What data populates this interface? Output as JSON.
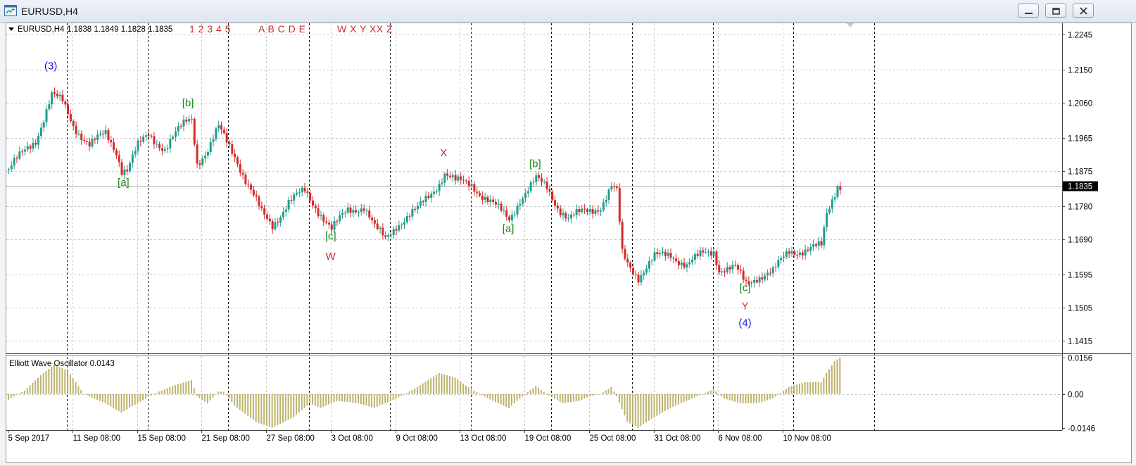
{
  "window": {
    "title": "EURUSD,H4",
    "app_icon": "chart-window-icon",
    "controls": [
      "minimize-icon",
      "restore-icon",
      "close-icon"
    ]
  },
  "header": {
    "symbol_tf": "EURUSD,H4",
    "ohlc": "1.1838 1.1849 1.1828 1.1835",
    "wave_tools": [
      "1 2 3 4 5",
      "A B C D E",
      "W X Y XX Z"
    ]
  },
  "colors": {
    "bull": "#1e9e8c",
    "bear": "#d42a2a",
    "oscillator": "#bdb36b",
    "green_label": "#1a8a1a",
    "red_label": "#cc2a2a",
    "blue_label": "#1414cc"
  },
  "chart_data": [
    {
      "type": "candlestick",
      "symbol": "EURUSD",
      "timeframe": "H4",
      "y_ticks": [
        "1.2245",
        "1.2150",
        "1.2060",
        "1.1965",
        "1.1875",
        "1.1780",
        "1.1690",
        "1.1595",
        "1.1505",
        "1.1415"
      ],
      "ylim": [
        1.1385,
        1.2275
      ],
      "current_price": "1.1835",
      "x_ticks": [
        "5 Sep 2017",
        "11 Sep 08:00",
        "15 Sep 08:00",
        "21 Sep 08:00",
        "27 Sep 08:00",
        "3 Oct 08:00",
        "9 Oct 08:00",
        "13 Oct 08:00",
        "19 Oct 08:00",
        "25 Oct 08:00",
        "31 Oct 08:00",
        "6 Nov 08:00",
        "10 Nov 08:00"
      ],
      "x_tick_index": [
        0,
        24,
        48,
        72,
        96,
        120,
        144,
        168,
        192,
        216,
        240,
        264,
        288
      ],
      "day_separators_index": [
        22,
        52,
        82,
        112,
        142,
        172,
        202,
        232,
        262,
        292,
        322
      ],
      "waypoints": [
        [
          0,
          1.188
        ],
        [
          10,
          1.196
        ],
        [
          16,
          1.208
        ],
        [
          20,
          1.206
        ],
        [
          24,
          1.2
        ],
        [
          30,
          1.1945
        ],
        [
          36,
          1.1975
        ],
        [
          40,
          1.193
        ],
        [
          42,
          1.188
        ],
        [
          44,
          1.188
        ],
        [
          48,
          1.194
        ],
        [
          52,
          1.1975
        ],
        [
          58,
          1.1935
        ],
        [
          66,
          1.201
        ],
        [
          68,
          1.202
        ],
        [
          70,
          1.19
        ],
        [
          74,
          1.193
        ],
        [
          78,
          1.199
        ],
        [
          84,
          1.192
        ],
        [
          88,
          1.185
        ],
        [
          94,
          1.176
        ],
        [
          98,
          1.173
        ],
        [
          104,
          1.179
        ],
        [
          110,
          1.182
        ],
        [
          116,
          1.176
        ],
        [
          120,
          1.1715
        ],
        [
          126,
          1.177
        ],
        [
          132,
          1.178
        ],
        [
          136,
          1.172
        ],
        [
          140,
          1.169
        ],
        [
          144,
          1.173
        ],
        [
          152,
          1.177
        ],
        [
          160,
          1.1845
        ],
        [
          162,
          1.187
        ],
        [
          166,
          1.1845
        ],
        [
          172,
          1.184
        ],
        [
          176,
          1.181
        ],
        [
          182,
          1.177
        ],
        [
          186,
          1.1745
        ],
        [
          190,
          1.18
        ],
        [
          196,
          1.185
        ],
        [
          200,
          1.183
        ],
        [
          204,
          1.178
        ],
        [
          208,
          1.1745
        ],
        [
          214,
          1.1765
        ],
        [
          220,
          1.178
        ],
        [
          224,
          1.183
        ],
        [
          226,
          1.1815
        ],
        [
          228,
          1.165
        ],
        [
          230,
          1.1625
        ],
        [
          234,
          1.159
        ],
        [
          240,
          1.164
        ],
        [
          246,
          1.165
        ],
        [
          252,
          1.162
        ],
        [
          258,
          1.165
        ],
        [
          262,
          1.166
        ],
        [
          264,
          1.161
        ],
        [
          270,
          1.161
        ],
        [
          274,
          1.157
        ],
        [
          278,
          1.159
        ],
        [
          284,
          1.16
        ],
        [
          290,
          1.166
        ],
        [
          296,
          1.166
        ],
        [
          302,
          1.167
        ],
        [
          304,
          1.176
        ],
        [
          306,
          1.18
        ],
        [
          308,
          1.184
        ],
        [
          309,
          1.1835
        ]
      ],
      "wave_labels": [
        {
          "text": "(3)",
          "color": "blue",
          "index": 16,
          "price": 1.215
        },
        {
          "text": "[b]",
          "color": "green",
          "index": 67,
          "price": 1.205
        },
        {
          "text": "[a]",
          "color": "green",
          "index": 43,
          "price": 1.1835
        },
        {
          "text": "[c]",
          "color": "green",
          "index": 120,
          "price": 1.169
        },
        {
          "text": "W",
          "color": "red",
          "index": 120,
          "price": 1.1635
        },
        {
          "text": "X",
          "color": "red",
          "index": 162,
          "price": 1.1915
        },
        {
          "text": "[b]",
          "color": "green",
          "index": 196,
          "price": 1.1885
        },
        {
          "text": "[a]",
          "color": "green",
          "index": 186,
          "price": 1.171
        },
        {
          "text": "[c]",
          "color": "green",
          "index": 274,
          "price": 1.155
        },
        {
          "text": "Y",
          "color": "red",
          "index": 274,
          "price": 1.15
        },
        {
          "text": "(4)",
          "color": "blue",
          "index": 274,
          "price": 1.1455
        }
      ]
    },
    {
      "type": "bar",
      "title": "Elliott Wave Oscillator 0.0143",
      "y_ticks": [
        "0.0156",
        "0.00",
        "-0.0146"
      ],
      "ylim": [
        -0.0155,
        0.0165
      ],
      "waypoints": [
        [
          0,
          -0.0025
        ],
        [
          6,
          0.0015
        ],
        [
          12,
          0.008
        ],
        [
          17,
          0.0125
        ],
        [
          22,
          0.01
        ],
        [
          28,
          0.0
        ],
        [
          36,
          -0.004
        ],
        [
          42,
          -0.008
        ],
        [
          48,
          -0.004
        ],
        [
          54,
          0.0
        ],
        [
          60,
          0.003
        ],
        [
          68,
          0.006
        ],
        [
          70,
          -0.001
        ],
        [
          74,
          -0.004
        ],
        [
          78,
          0.001
        ],
        [
          80,
          0.001
        ],
        [
          84,
          -0.005
        ],
        [
          92,
          -0.012
        ],
        [
          98,
          -0.0145
        ],
        [
          106,
          -0.01
        ],
        [
          112,
          -0.004
        ],
        [
          116,
          -0.006
        ],
        [
          122,
          -0.003
        ],
        [
          130,
          -0.004
        ],
        [
          136,
          -0.006
        ],
        [
          140,
          -0.004
        ],
        [
          144,
          -0.002
        ],
        [
          152,
          0.003
        ],
        [
          160,
          0.009
        ],
        [
          166,
          0.007
        ],
        [
          172,
          0.002
        ],
        [
          180,
          -0.003
        ],
        [
          186,
          -0.006
        ],
        [
          190,
          -0.002
        ],
        [
          196,
          0.0035
        ],
        [
          200,
          0.0
        ],
        [
          206,
          -0.004
        ],
        [
          212,
          -0.003
        ],
        [
          216,
          -0.001
        ],
        [
          220,
          0.0
        ],
        [
          224,
          0.003
        ],
        [
          226,
          -0.001
        ],
        [
          230,
          -0.012
        ],
        [
          234,
          -0.0145
        ],
        [
          240,
          -0.01
        ],
        [
          246,
          -0.006
        ],
        [
          252,
          -0.003
        ],
        [
          258,
          0.0
        ],
        [
          262,
          0.002
        ],
        [
          266,
          -0.002
        ],
        [
          272,
          -0.004
        ],
        [
          278,
          -0.004
        ],
        [
          284,
          -0.002
        ],
        [
          290,
          0.003
        ],
        [
          296,
          0.005
        ],
        [
          302,
          0.005
        ],
        [
          304,
          0.009
        ],
        [
          307,
          0.014
        ],
        [
          309,
          0.0156
        ]
      ]
    }
  ]
}
